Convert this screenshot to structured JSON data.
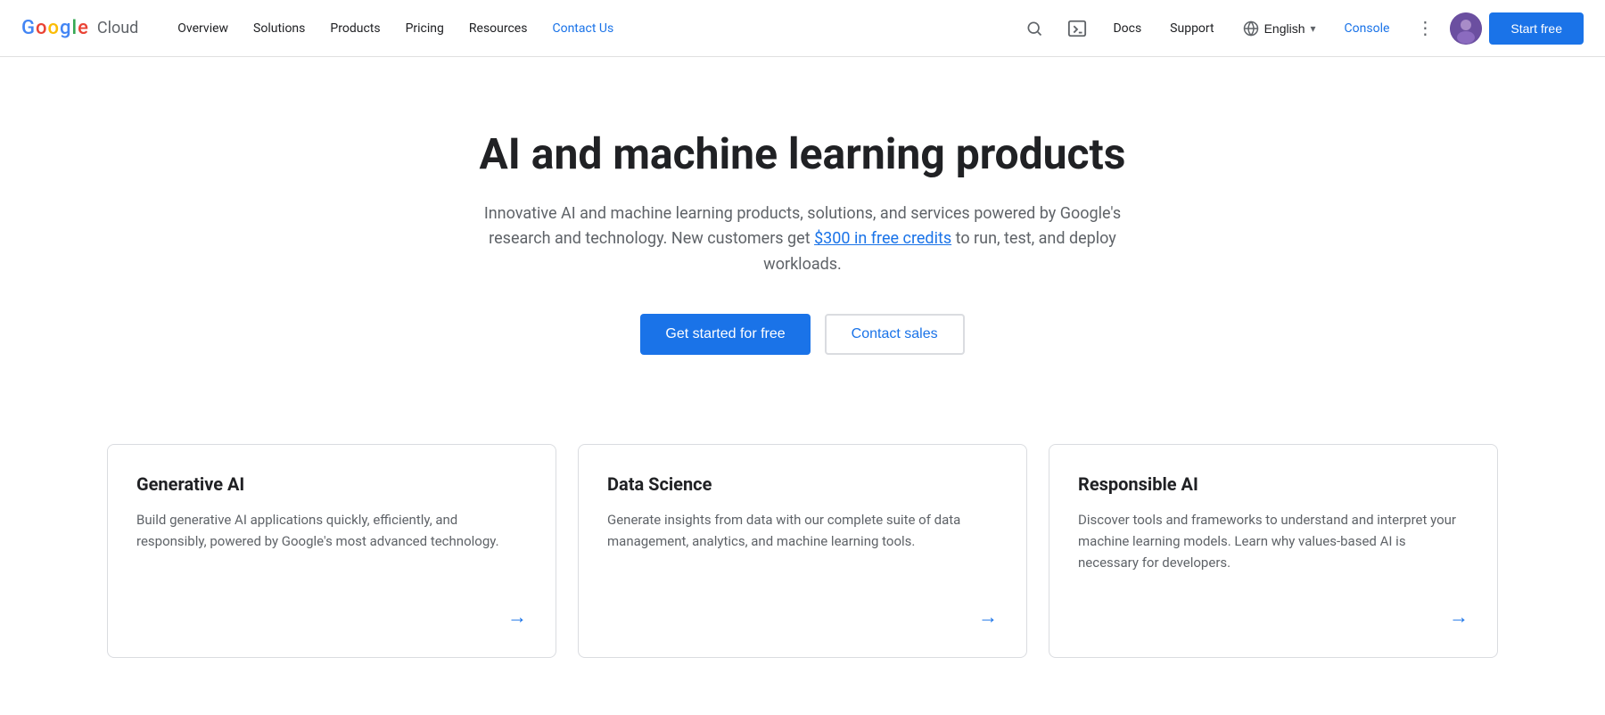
{
  "brand": {
    "g": "G",
    "google": "oogle",
    "cloud": "Cloud"
  },
  "navbar": {
    "items": [
      {
        "label": "Overview",
        "active": false
      },
      {
        "label": "Solutions",
        "active": false
      },
      {
        "label": "Products",
        "active": false
      },
      {
        "label": "Pricing",
        "active": false
      },
      {
        "label": "Resources",
        "active": false
      },
      {
        "label": "Contact Us",
        "active": true
      }
    ],
    "docs": "Docs",
    "support": "Support",
    "language": "English",
    "console": "Console",
    "start_free": "Start free"
  },
  "hero": {
    "title": "AI and machine learning products",
    "description_before": "Innovative AI and machine learning products, solutions, and services powered by Google's research and technology. New customers get ",
    "credits_link": "$300 in free credits",
    "description_after": " to run, test, and deploy workloads.",
    "btn_primary": "Get started for free",
    "btn_secondary": "Contact sales"
  },
  "cards": [
    {
      "title": "Generative AI",
      "description": "Build generative AI applications quickly, efficiently, and responsibly, powered by Google's most advanced technology.",
      "arrow": "→"
    },
    {
      "title": "Data Science",
      "description": "Generate insights from data with our complete suite of data management, analytics, and machine learning tools.",
      "arrow": "→"
    },
    {
      "title": "Responsible AI",
      "description": "Discover tools and frameworks to understand and interpret your machine learning models. Learn why values-based AI is necessary for developers.",
      "arrow": "→"
    }
  ],
  "colors": {
    "primary_blue": "#1a73e8",
    "text_dark": "#202124",
    "text_muted": "#5f6368"
  }
}
